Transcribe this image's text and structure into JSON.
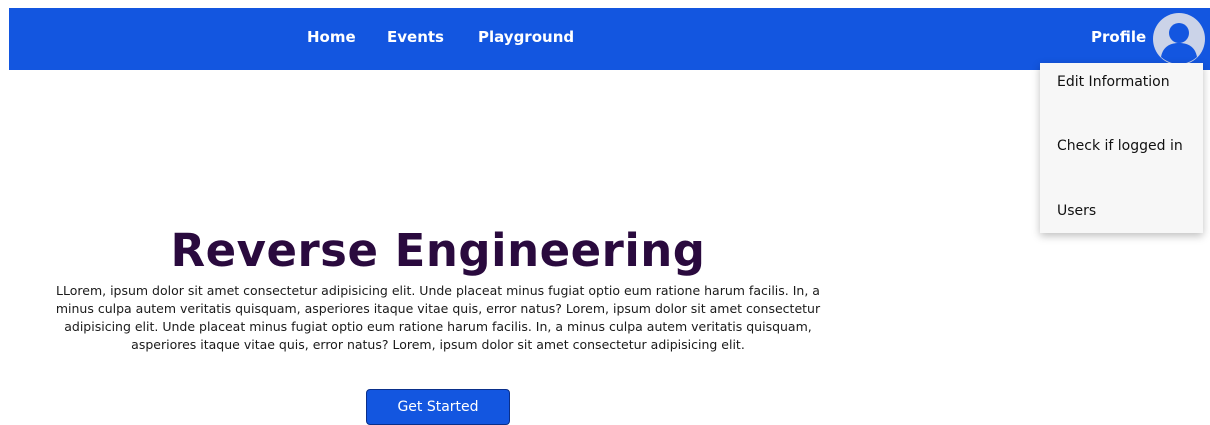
{
  "navbar": {
    "links": [
      "Home",
      "Events",
      "Playground"
    ],
    "profile_label": "Profile",
    "avatar_icon": "user-icon",
    "brand_color": "#1356e0"
  },
  "dropdown": {
    "items": [
      "Edit Information",
      "Check if logged in",
      "Users"
    ]
  },
  "hero": {
    "title": "Reverse Engineering",
    "body": "LLorem, ipsum dolor sit amet consectetur adipisicing elit. Unde placeat minus fugiat optio eum ratione harum facilis. In, a minus culpa autem veritatis quisquam, asperiores itaque vitae quis, error natus? Lorem, ipsum dolor sit amet consectetur adipisicing elit. Unde placeat minus fugiat optio eum ratione harum facilis. In, a minus culpa autem veritatis quisquam, asperiores itaque vitae quis, error natus? Lorem, ipsum dolor sit amet consectetur adipisicing elit.",
    "cta_label": "Get Started"
  }
}
